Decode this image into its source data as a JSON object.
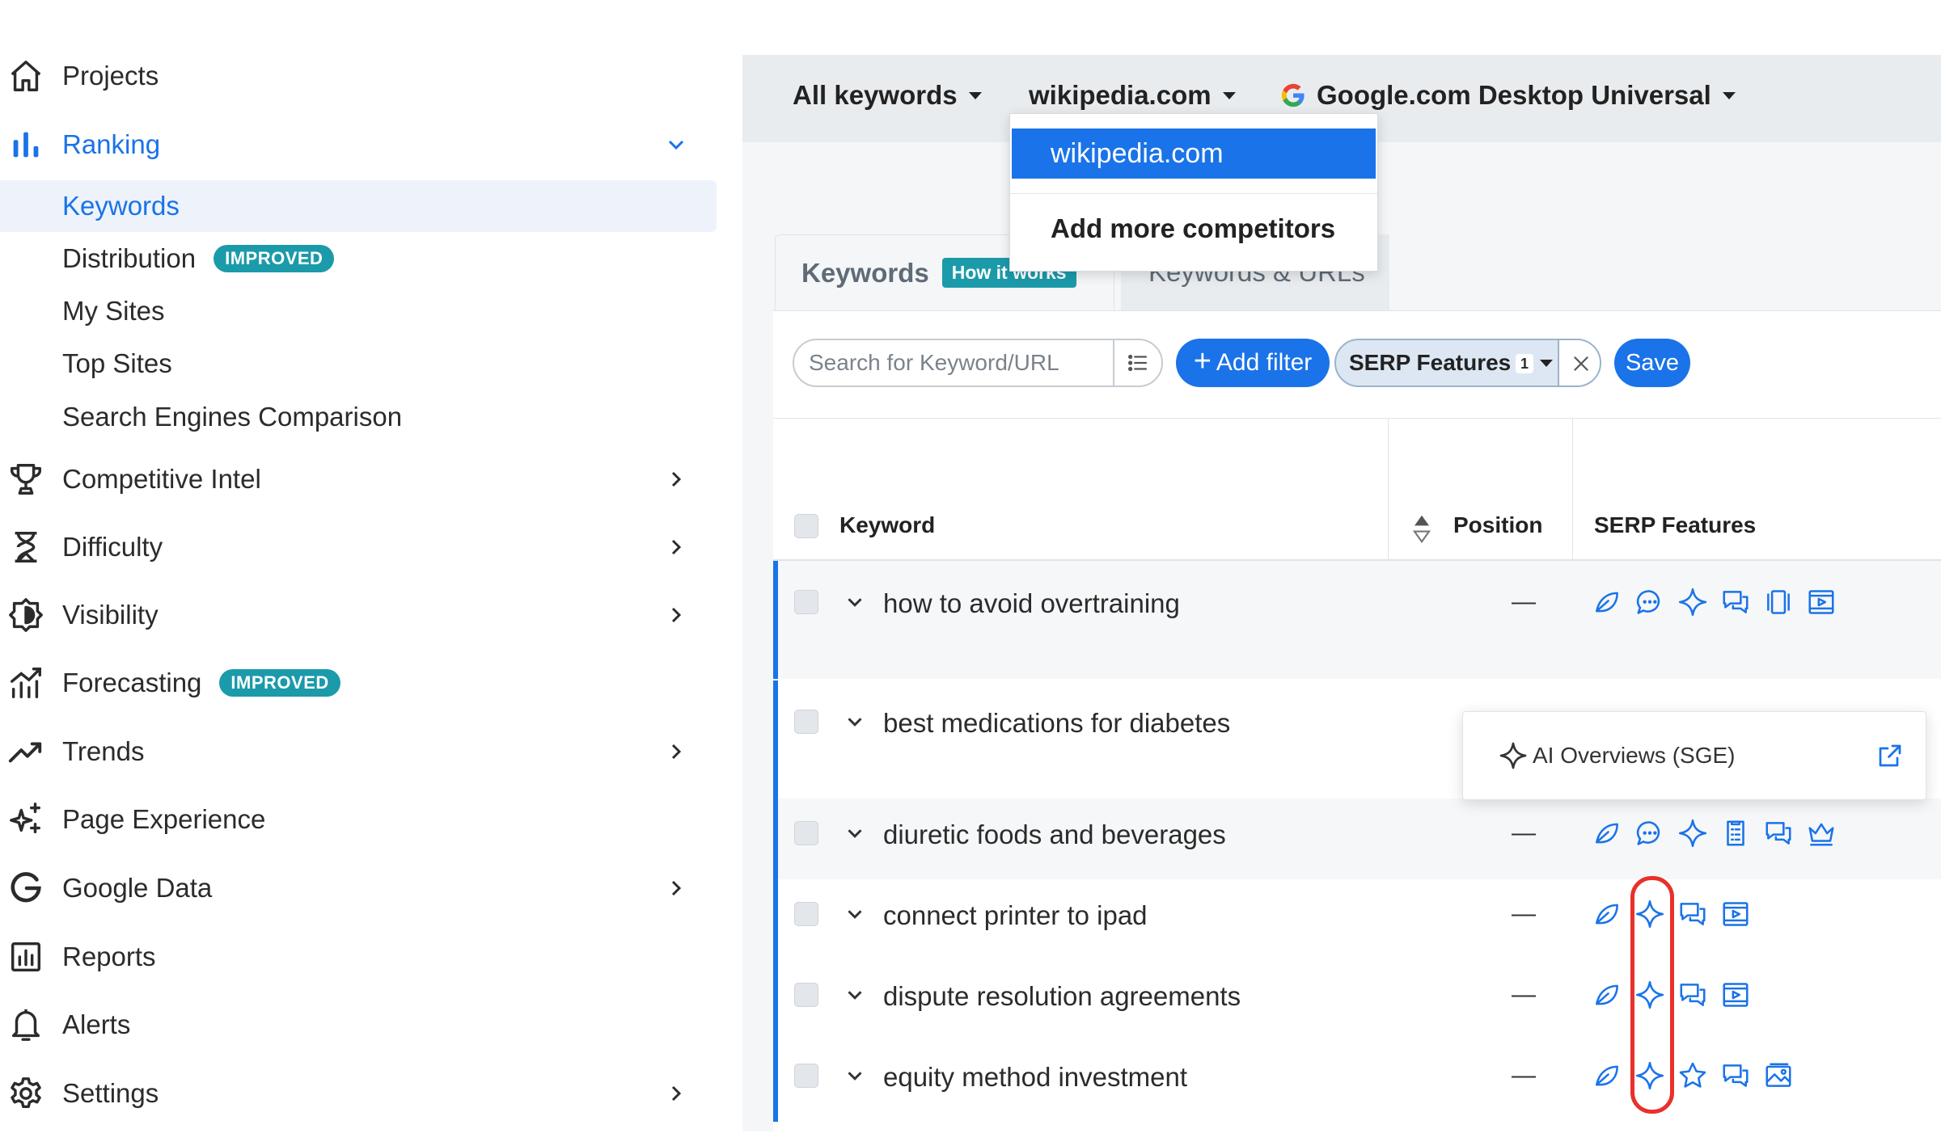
{
  "sidebar": {
    "items": [
      {
        "label": "Projects",
        "icon": "home-icon"
      },
      {
        "label": "Ranking",
        "icon": "bar-chart-icon",
        "expanded": true
      },
      {
        "label": "Competitive Intel",
        "icon": "trophy-icon"
      },
      {
        "label": "Difficulty",
        "icon": "hourglass-icon"
      },
      {
        "label": "Visibility",
        "icon": "visibility-icon"
      },
      {
        "label": "Forecasting",
        "icon": "forecast-chart-icon",
        "badge": "IMPROVED"
      },
      {
        "label": "Trends",
        "icon": "trend-line-icon"
      },
      {
        "label": "Page Experience",
        "icon": "sparkle-icon"
      },
      {
        "label": "Google Data",
        "icon": "google-g-icon"
      },
      {
        "label": "Reports",
        "icon": "report-icon"
      },
      {
        "label": "Alerts",
        "icon": "bell-icon"
      },
      {
        "label": "Settings",
        "icon": "gear-icon"
      }
    ],
    "ranking_sub": [
      {
        "label": "Keywords",
        "selected": true
      },
      {
        "label": "Distribution",
        "badge": "IMPROVED"
      },
      {
        "label": "My Sites"
      },
      {
        "label": "Top Sites"
      },
      {
        "label": "Search Engines Comparison"
      }
    ]
  },
  "topbar": {
    "keywords_filter": "All keywords",
    "site": "wikipedia.com",
    "engine": "Google.com Desktop Universal"
  },
  "site_menu": {
    "selected": "wikipedia.com",
    "add": "Add more competitors"
  },
  "tabs": {
    "keywords": "Keywords",
    "how_it_works": "How it works",
    "urls": "Keywords & URLs"
  },
  "filters": {
    "search_placeholder": "Search for Keyword/URL",
    "add_filter": "Add filter",
    "serp_filter": "SERP Features",
    "serp_count": "1",
    "save": "Save"
  },
  "table": {
    "headers": {
      "keyword": "Keyword",
      "position": "Position",
      "serp": "SERP Features"
    },
    "rows": [
      {
        "keyword": "how to avoid overtraining",
        "position": "—",
        "serp_icons": [
          "leaf-icon",
          "chat-bubble-icon",
          "ai-sparkle-icon",
          "reviews-icon",
          "carousel-icon",
          "video-icon"
        ]
      },
      {
        "keyword": "best medications for diabetes",
        "position": "",
        "serp_icons": []
      },
      {
        "keyword": "diuretic foods and beverages",
        "position": "—",
        "serp_icons": [
          "leaf-icon",
          "chat-bubble-icon",
          "ai-sparkle-icon",
          "list-icon",
          "reviews-icon",
          "crown-icon"
        ]
      },
      {
        "keyword": "connect printer to ipad",
        "position": "—",
        "serp_icons": [
          "leaf-icon",
          "ai-sparkle-icon",
          "reviews-icon",
          "video-icon"
        ]
      },
      {
        "keyword": "dispute resolution agreements",
        "position": "—",
        "serp_icons": [
          "leaf-icon",
          "ai-sparkle-icon",
          "reviews-icon",
          "video-icon"
        ]
      },
      {
        "keyword": "equity method investment",
        "position": "—",
        "serp_icons": [
          "leaf-icon",
          "ai-sparkle-icon",
          "star-icon",
          "reviews-icon",
          "image-icon"
        ]
      }
    ]
  },
  "tooltip": {
    "label": "AI Overviews (SGE)"
  },
  "colors": {
    "accent": "#1a73e8",
    "badge": "#1b9aaa",
    "highlight": "#e8312a"
  }
}
